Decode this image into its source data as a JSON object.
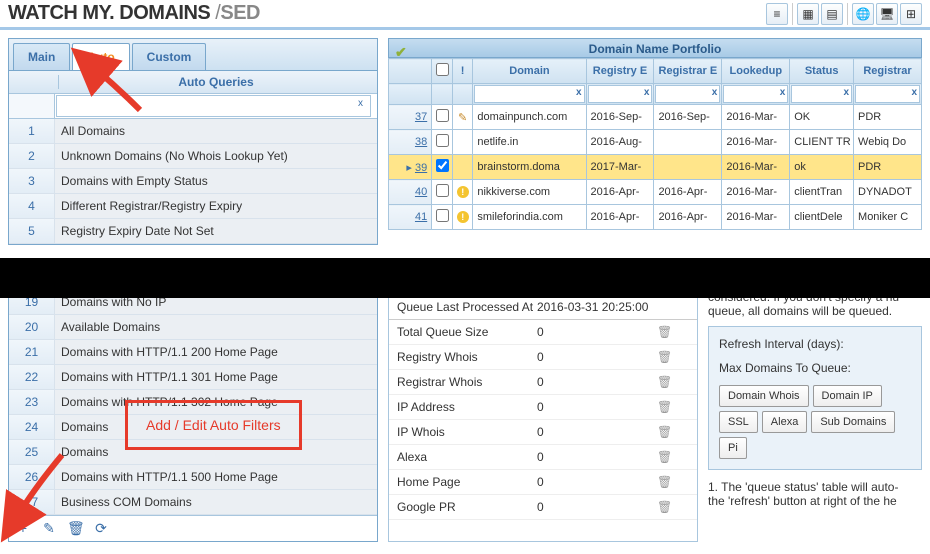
{
  "header": {
    "logo_a": "WATCH MY.",
    "logo_b": " DOMAINS ",
    "logo_slash": "/",
    "logo_c": "SED"
  },
  "tabs": {
    "main": "Main",
    "auto": "Auto",
    "custom": "Custom"
  },
  "aq": {
    "title": "Auto Queries",
    "top": [
      {
        "n": "1",
        "t": "All Domains"
      },
      {
        "n": "2",
        "t": "Unknown Domains (No Whois Lookup Yet)"
      },
      {
        "n": "3",
        "t": "Domains with Empty Status"
      },
      {
        "n": "4",
        "t": "Different Registrar/Registry Expiry"
      },
      {
        "n": "5",
        "t": "Registry Expiry Date Not Set"
      }
    ],
    "bot": [
      {
        "n": "19",
        "t": "Domains with No IP"
      },
      {
        "n": "20",
        "t": "Available Domains"
      },
      {
        "n": "21",
        "t": "Domains with HTTP/1.1 200 Home Page"
      },
      {
        "n": "22",
        "t": "Domains with HTTP/1.1 301 Home Page"
      },
      {
        "n": "23",
        "t": "Domains with HTTP/1.1 302 Home Page"
      },
      {
        "n": "24",
        "t": "Domains"
      },
      {
        "n": "25",
        "t": "Domains"
      },
      {
        "n": "26",
        "t": "Domains with HTTP/1.1 500 Home Page"
      },
      {
        "n": "27",
        "t": "Business COM Domains"
      }
    ]
  },
  "annot": "Add / Edit Auto Filters",
  "grid": {
    "title": "Domain Name Portfolio",
    "cols": {
      "bang": "!",
      "domain": "Domain",
      "regexp": "Registry E",
      "regbexp": "Registrar E",
      "lookedup": "Lookedup",
      "status": "Status",
      "registrar": "Registrar"
    },
    "rows": [
      {
        "n": "37",
        "sel": false,
        "ico": "edit",
        "domain": "domainpunch.com",
        "regexp": "2016-Sep-",
        "regbexp": "2016-Sep-",
        "lookedup": "2016-Mar-",
        "status": "OK",
        "registrar": "PDR"
      },
      {
        "n": "38",
        "sel": false,
        "ico": "",
        "domain": "netlife.in",
        "regexp": "2016-Aug-",
        "regbexp": "",
        "lookedup": "2016-Mar-",
        "status": "CLIENT TR",
        "registrar": "Webiq Do"
      },
      {
        "n": "39",
        "sel": true,
        "ico": "",
        "domain": "brainstorm.doma",
        "regexp": "2017-Mar-",
        "regbexp": "",
        "lookedup": "2016-Mar-",
        "status": "ok",
        "registrar": "PDR"
      },
      {
        "n": "40",
        "sel": false,
        "ico": "warn",
        "domain": "nikkiverse.com",
        "regexp": "2016-Apr-",
        "regbexp": "2016-Apr-",
        "lookedup": "2016-Mar-",
        "status": "clientTran",
        "registrar": "DYNADOT"
      },
      {
        "n": "41",
        "sel": false,
        "ico": "warn",
        "domain": "smileforindia.com",
        "regexp": "2016-Apr-",
        "regbexp": "2016-Apr-",
        "lookedup": "2016-Mar-",
        "status": "clientDele",
        "registrar": "Moniker C"
      }
    ]
  },
  "queue": {
    "last_label": "Queue Last Processed At",
    "last_val": "2016-03-31 20:25:00",
    "rows": [
      {
        "l": "Total Queue Size",
        "v": "0"
      },
      {
        "l": "Registry Whois",
        "v": "0"
      },
      {
        "l": "Registrar Whois",
        "v": "0"
      },
      {
        "l": "IP Address",
        "v": "0"
      },
      {
        "l": "IP Whois",
        "v": "0"
      },
      {
        "l": "Alexa",
        "v": "0"
      },
      {
        "l": "Home Page",
        "v": "0"
      },
      {
        "l": "Google PR",
        "v": "0"
      }
    ]
  },
  "side": {
    "note_a": "considered. If you don't specify a nu",
    "note_b": "queue, all domains will be queued.",
    "refresh": "Refresh Interval (days):",
    "maxq": "Max Domains To Queue:",
    "btns": [
      "Domain Whois",
      "Domain IP",
      "SSL",
      "Alexa",
      "Sub Domains",
      "Pi"
    ],
    "foot_a": "1. The 'queue status' table will auto-",
    "foot_b": "the 'refresh' button at right of the he"
  }
}
